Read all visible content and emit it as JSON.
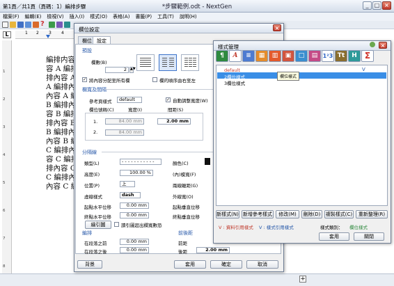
{
  "window": {
    "title": "*步驟範例.odt - NextGen",
    "menu": [
      "檔案(F)",
      "編輯(E)",
      "檢視(V)",
      "插入(I)",
      "樣式(O)",
      "表格(A)",
      "書籤(P)",
      "工具(T)",
      "說明(H)"
    ]
  },
  "document": {
    "lines": [
      "編排内容",
      "容 A 編排",
      "排內容 A",
      "A 編排內",
      "內容 A 編",
      "B 編排內容",
      "容 B 編排",
      "排內容 B",
      "B 編排內",
      "內容 B 編",
      "C 編排內容",
      "容 C 編排",
      "排內容 C",
      "C 編排內",
      "內容 C 編"
    ]
  },
  "statusbar": {
    "text": "第1頁／共1頁（頁碼：1）編排步驟"
  },
  "para_dialog": {
    "title": "欄位設定",
    "tabs": [
      "欄位",
      "設定"
    ],
    "preset_label": "預設",
    "columns_label": "欄數(B)",
    "columns_value": "2",
    "even_check": "將內容分配至所有欄",
    "even_checked": true,
    "rtl_check": "欄的順序由右至左",
    "rtl_checked": false,
    "width_section": "欄寬及間隔",
    "ref_style_label": "參考頁樣式",
    "ref_style_value": "default",
    "auto_width_check": "自動調整寬度(W)",
    "auto_width_checked": true,
    "col_no_header": "欄位號碼(C)",
    "width_header": "寬度(I)",
    "spacing_header": "間距(S)",
    "row1_no": "1.",
    "row1_width": "84.00 mm",
    "row1_spacing": "2.00 mm",
    "row2_no": "2.",
    "row2_width": "84.00 mm",
    "sep_section": "分隔線",
    "type_label": "類型(L)",
    "type_value": "- - - - - - - - - - -",
    "color_label": "顏色(C)",
    "height_label": "高度(E)",
    "height_value": "100.00 %",
    "inner_spacing_label": "(內)模寬(F)",
    "position_label": "位置(P)",
    "position_value": "上",
    "double_side_label": "兩線離距(G)",
    "style_label": "虛線樣式",
    "style_value": "dash",
    "ext_space_label": "外線寬(O)",
    "start_h_label": "起點水平位移",
    "start_h_value": "0.00 mm",
    "start_v_label": "起點垂直位移",
    "end_h_label": "終點水平位移",
    "end_h_value": "0.00 mm",
    "end_v_label": "終點垂直位移",
    "draw_button": "繪引圖",
    "draw_check": "讀引圖超出欄寬數恐",
    "layout_section": "編排",
    "before_label": "在段落之前",
    "before_value": "0.00 mm",
    "after_label": "在段落之後",
    "after_value": "0.00 mm",
    "indent_section": "前後距",
    "indent_front_label": "前距",
    "indent_back_label": "後距",
    "indent_back_value": "2.00 mm",
    "background_button": "背景",
    "apply_button": "套用",
    "ok_button": "確定",
    "cancel_button": "取消"
  },
  "style_dialog": {
    "title": "樣式管理",
    "tree": [
      "default",
      "2欄位樣式",
      "3欄位樣式"
    ],
    "tooltip": "欄位樣式",
    "flag": "V",
    "buttons": [
      "新樣式(N)",
      "新增參考樣式",
      "修改(M)",
      "刪除(D)",
      "複製樣式(C)",
      "重新整理(R)"
    ],
    "legend_left": "V : 資料引用樣式",
    "legend_right": "V : 樣式引用樣式",
    "category_label": "樣式類別：",
    "category_value": "欄位樣式",
    "apply_button": "套用",
    "close_button": "關閉",
    "icon_names": [
      "paragraph-style-icon",
      "character-style-icon",
      "list-style-icon",
      "table-style-icon",
      "column-style-icon",
      "frame-style-icon",
      "page-style-icon",
      "image-style-icon",
      "numbering-style-icon",
      "text-style-icon",
      "heading-style-icon",
      "sum-style-icon"
    ]
  },
  "colors": {
    "accent": "#2456a8",
    "selection": "#3a8ee6",
    "title_bar": "#dbe3ee",
    "close": "#c4392a"
  }
}
